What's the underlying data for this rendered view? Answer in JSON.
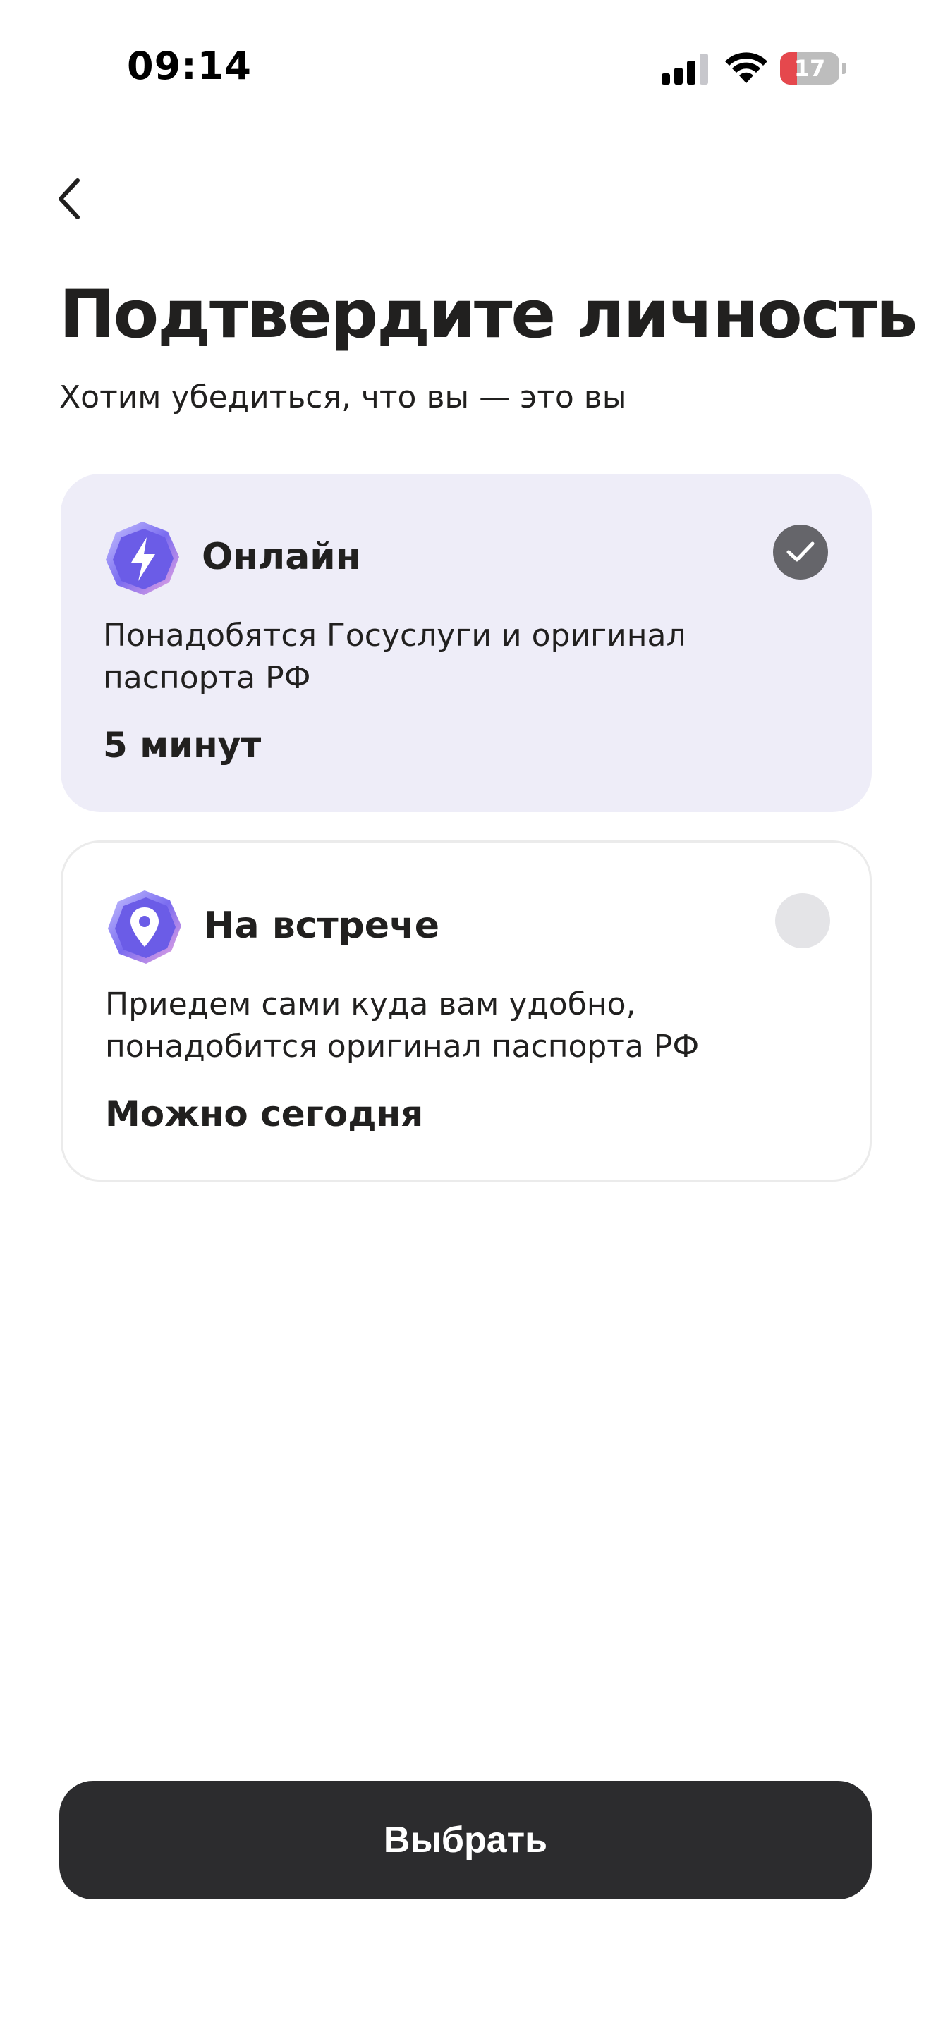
{
  "status_bar": {
    "time": "09:14",
    "battery_percent": "17",
    "battery_level": 0.17,
    "icons": [
      "signal-icon",
      "wifi-icon",
      "battery-icon"
    ]
  },
  "nav": {
    "back_icon": "chevron-left-icon"
  },
  "header": {
    "title": "Подтвердите личность",
    "subtitle": "Хотим убедиться, что вы — это вы"
  },
  "options": [
    {
      "title": "Онлайн",
      "description": "Понадобятся Госуслуги и оригинал паспорта РФ",
      "time": "5 минут",
      "icon": "lightning-badge-icon",
      "selected": true
    },
    {
      "title": "На встрече",
      "description": "Приедем сами куда вам удобно, понадобится оригинал паспорта РФ",
      "time": "Можно сегодня",
      "icon": "location-pin-badge-icon",
      "selected": false
    }
  ],
  "actions": {
    "primary_label": "Выбрать"
  },
  "colors": {
    "accent_card": "#eeedf8",
    "badge_purple": "#6b5ce7",
    "button": "#2c2c2e",
    "radio_checked": "#65656a",
    "battery_low": "#e5484d"
  }
}
